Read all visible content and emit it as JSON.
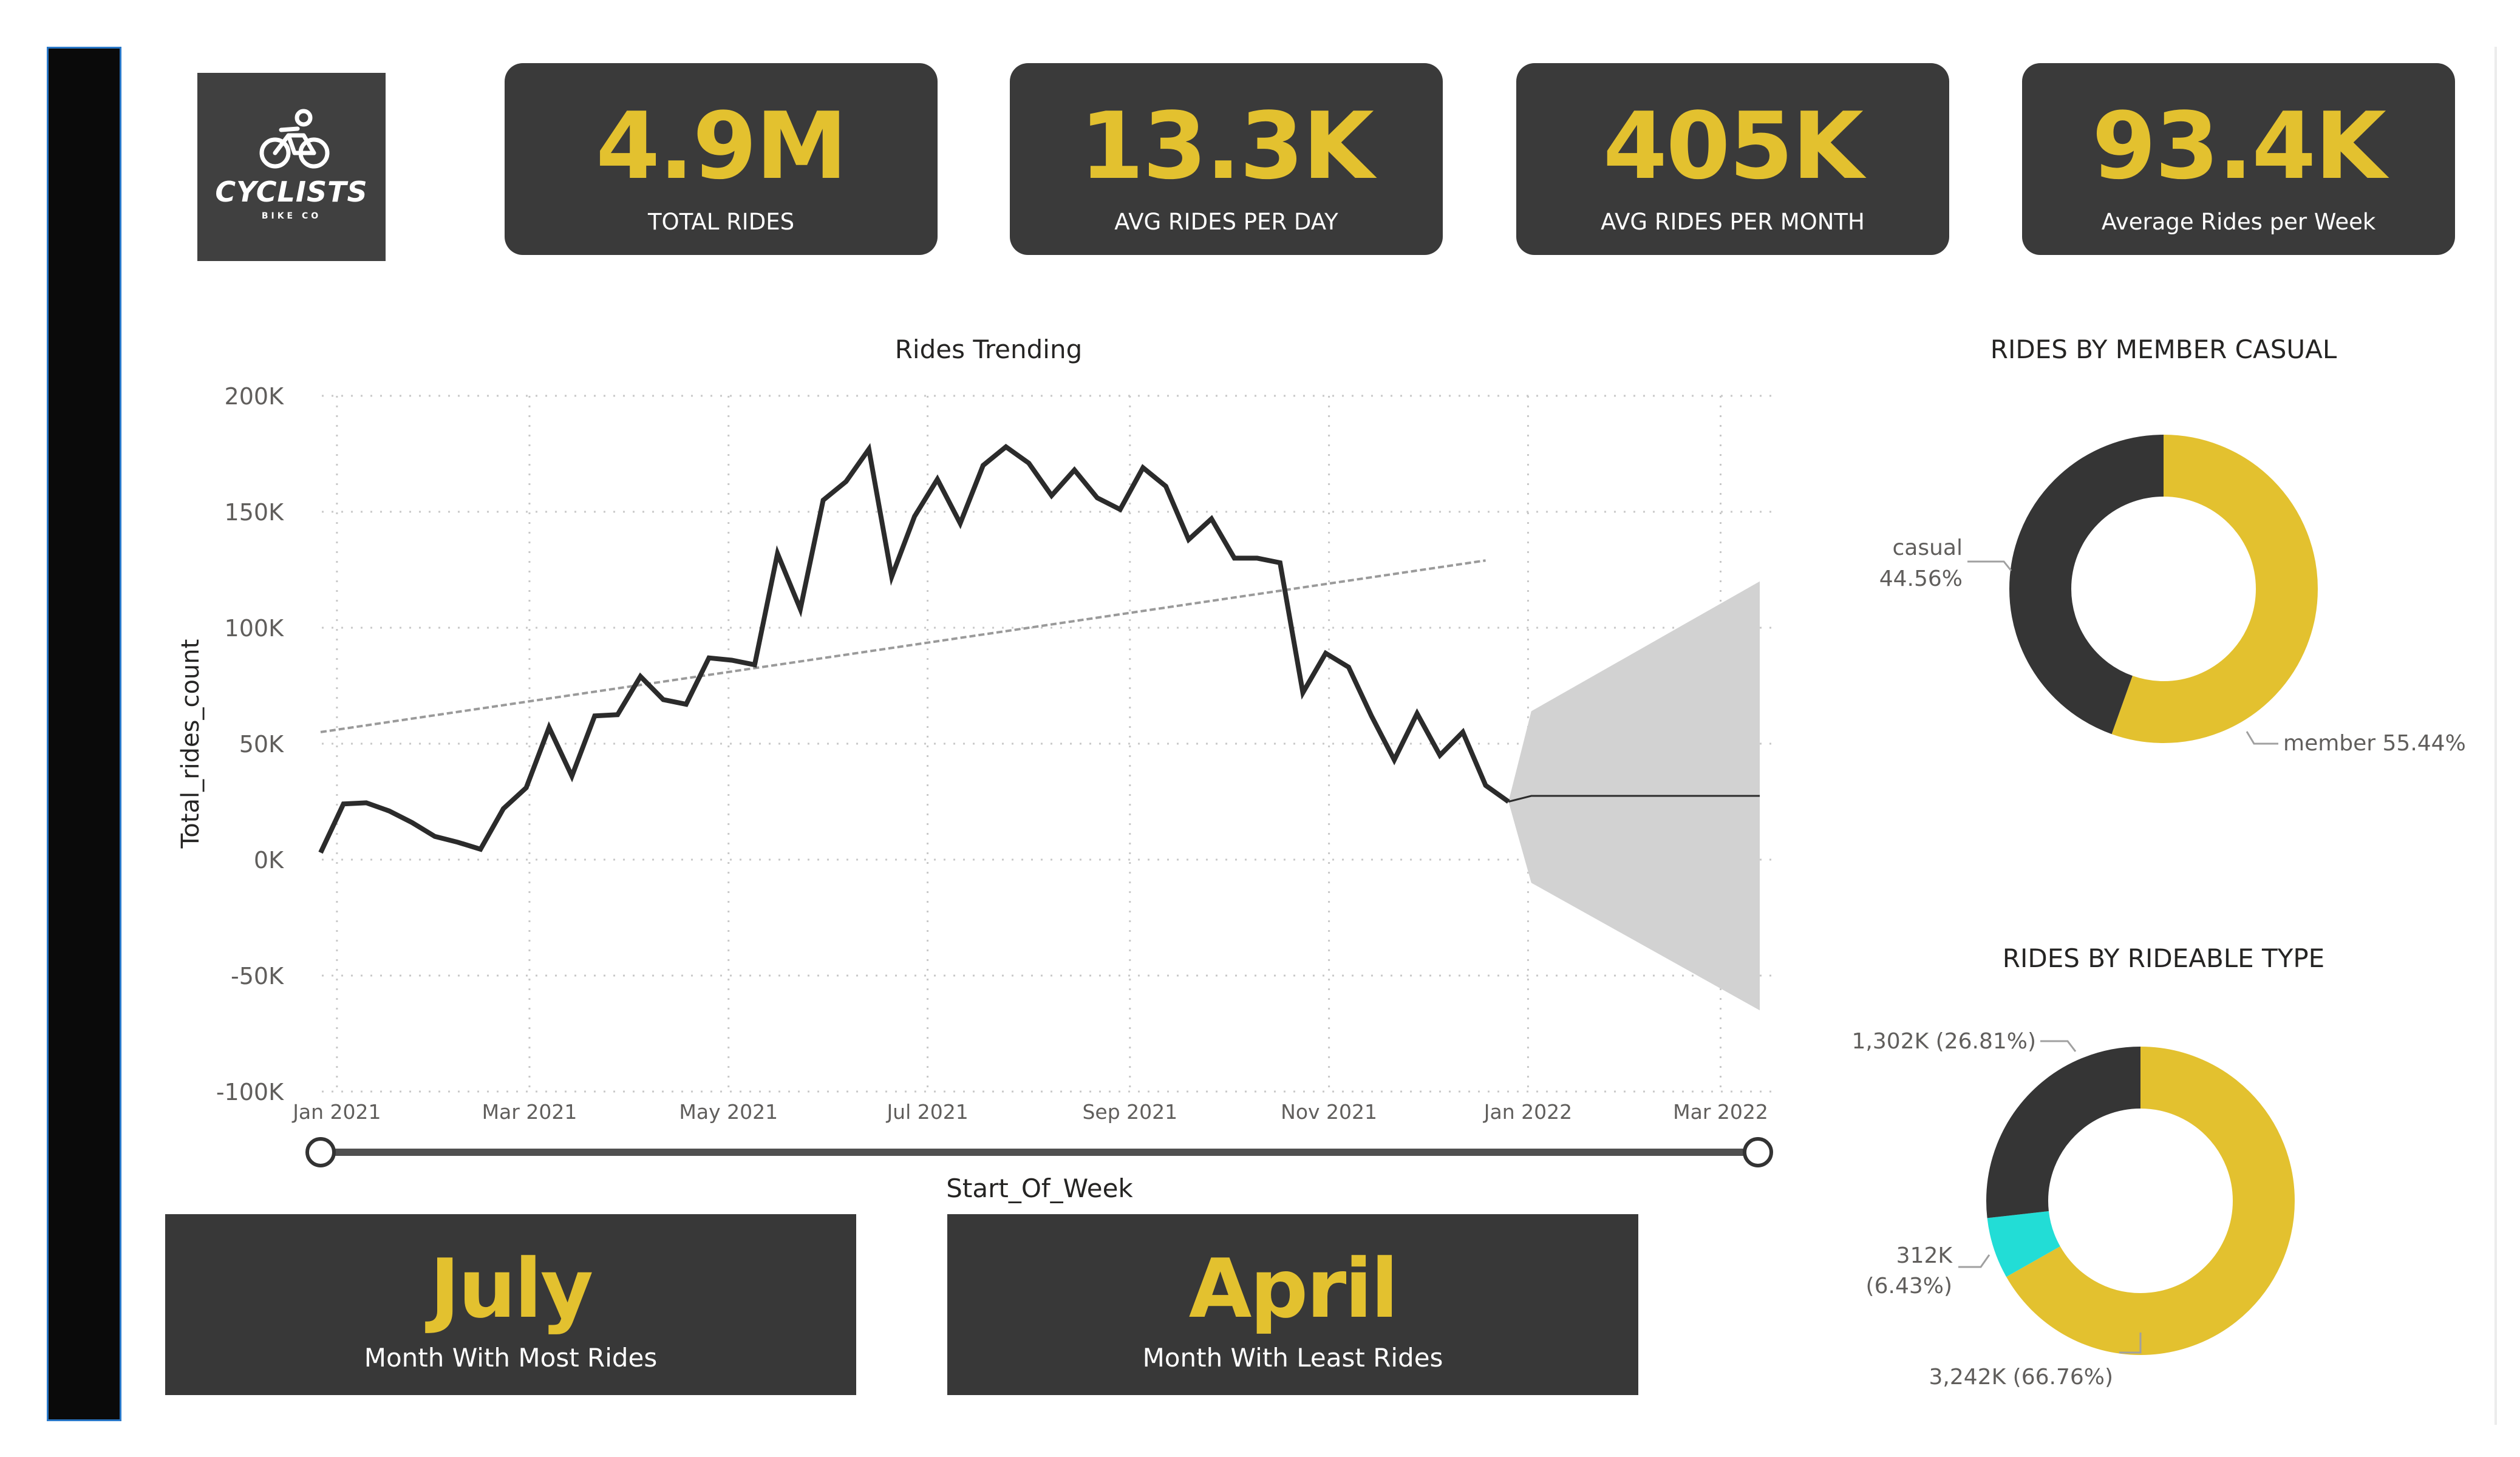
{
  "logo": {
    "brand": "CYCLISTS",
    "tagline": "BIKE CO",
    "icon": "bicycle-rider-icon"
  },
  "kpis": [
    {
      "value": "4.9M",
      "label": "TOTAL RIDES"
    },
    {
      "value": "13.3K",
      "label": "AVG RIDES PER DAY"
    },
    {
      "value": "405K",
      "label": "AVG RIDES PER MONTH"
    },
    {
      "value": "93.4K",
      "label": "Average Rides per Week"
    }
  ],
  "month_cards": [
    {
      "value": "July",
      "label": "Month With Most Rides"
    },
    {
      "value": "April",
      "label": "Month With Least Rides"
    }
  ],
  "colors": {
    "accent": "#e3c12f",
    "dark": "#3a3a3a",
    "teal": "#22ddd6",
    "line": "#2b2b2b",
    "forecast_band": "#d2d2d2"
  },
  "chart_data": [
    {
      "type": "line",
      "title": "Rides Trending",
      "xlabel": "Start_Of_Week",
      "ylabel": "Total_rides_count",
      "ylim": [
        -100000,
        200000
      ],
      "y_ticks": [
        "200K",
        "150K",
        "100K",
        "50K",
        "0K",
        "-50K",
        "-100K"
      ],
      "x_ticks": [
        "Jan 2021",
        "Mar 2021",
        "May 2021",
        "Jul 2021",
        "Sep 2021",
        "Nov 2021",
        "Jan 2022",
        "Mar 2022"
      ],
      "grid": true,
      "series": [
        {
          "x": [
            "2020-12-27",
            "2021-01-03",
            "2021-01-10",
            "2021-01-17",
            "2021-01-24",
            "2021-01-31",
            "2021-02-07",
            "2021-02-14",
            "2021-02-21",
            "2021-02-28",
            "2021-03-07",
            "2021-03-14",
            "2021-03-21",
            "2021-03-28",
            "2021-04-04",
            "2021-04-11",
            "2021-04-18",
            "2021-04-25",
            "2021-05-02",
            "2021-05-09",
            "2021-05-16",
            "2021-05-23",
            "2021-05-30",
            "2021-06-06",
            "2021-06-13",
            "2021-06-20",
            "2021-06-27",
            "2021-07-04",
            "2021-07-11",
            "2021-07-18",
            "2021-07-25",
            "2021-08-01",
            "2021-08-08",
            "2021-08-15",
            "2021-08-22",
            "2021-08-29",
            "2021-09-05",
            "2021-09-12",
            "2021-09-19",
            "2021-09-26",
            "2021-10-03",
            "2021-10-10",
            "2021-10-17",
            "2021-10-24",
            "2021-10-31",
            "2021-11-07",
            "2021-11-14",
            "2021-11-21",
            "2021-11-28",
            "2021-12-05",
            "2021-12-12",
            "2021-12-19",
            "2021-12-26"
          ],
          "y": [
            3000,
            24000,
            24500,
            21000,
            16000,
            10000,
            7500,
            4500,
            22000,
            31000,
            57000,
            36000,
            62000,
            62500,
            79000,
            69000,
            67000,
            87000,
            86000,
            84000,
            132000,
            108000,
            155000,
            163000,
            177000,
            122000,
            148000,
            164000,
            145000,
            170000,
            178000,
            171000,
            157000,
            168000,
            156000,
            151000,
            169000,
            161000,
            138000,
            147000,
            130000,
            130000,
            128000,
            72000,
            89000,
            83000,
            62000,
            43000,
            63000,
            45000,
            55000,
            32000,
            25000
          ]
        }
      ],
      "trend_line": {
        "x": [
          "2020-12-27",
          "2021-12-19"
        ],
        "y": [
          55000,
          129000
        ]
      },
      "forecast": {
        "x": [
          "2021-12-26",
          "2022-01-02",
          "2022-03-13"
        ],
        "y": [
          25000,
          27500,
          27500
        ],
        "upper": [
          25000,
          64000,
          120000
        ],
        "lower": [
          25000,
          -10000,
          -65000
        ]
      }
    },
    {
      "type": "pie",
      "style": "donut",
      "title": "RIDES BY MEMBER CASUAL",
      "labels": [
        "member",
        "casual"
      ],
      "values": [
        55.44,
        44.56
      ],
      "value_labels": [
        "member 55.44%",
        "casual",
        "44.56%"
      ],
      "colors": [
        "#e3c12f",
        "#353535"
      ]
    },
    {
      "type": "pie",
      "style": "donut",
      "title": "RIDES BY RIDEABLE TYPE",
      "labels": [
        "3,242K (66.76%)",
        "312K (6.43%)",
        "1,302K (26.81%)"
      ],
      "values": [
        3242,
        312,
        1302
      ],
      "value_labels": [
        "1,302K (26.81%)",
        "312K",
        "(6.43%)",
        "3,242K (66.76%)"
      ],
      "colors": [
        "#e3c12f",
        "#22ddd6",
        "#353535"
      ]
    }
  ]
}
